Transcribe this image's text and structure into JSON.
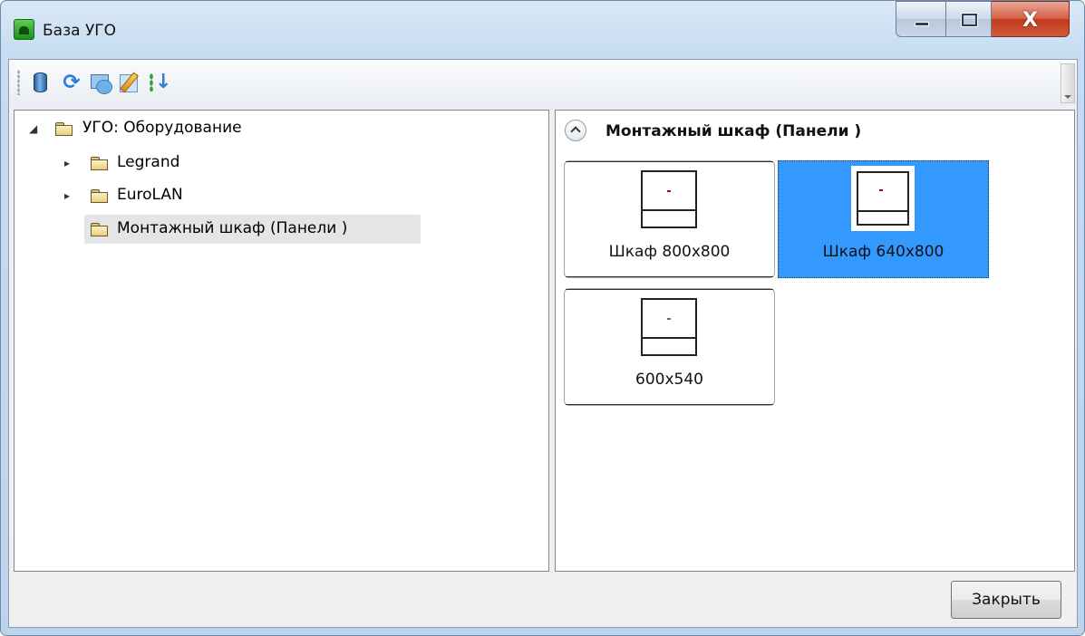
{
  "window": {
    "title": "База УГО",
    "icon": "app-icon",
    "controls": [
      "minimize-icon",
      "maximize-icon",
      "close-icon"
    ],
    "close_glyph": "X"
  },
  "toolbar": {
    "buttons": [
      {
        "icon": "database-icon"
      },
      {
        "icon": "refresh-icon"
      },
      {
        "icon": "sync-icon"
      },
      {
        "icon": "edit-icon"
      },
      {
        "icon": "sort-icon"
      }
    ]
  },
  "tree": {
    "root": {
      "label": "УГО: Оборудование",
      "expanded": true
    },
    "children": [
      {
        "label": "Legrand",
        "expanded": false
      },
      {
        "label": "EuroLAN",
        "expanded": false
      },
      {
        "label": "Монтажный шкаф (Панели )",
        "selected": true
      }
    ]
  },
  "gallery": {
    "group_title": "Монтажный шкаф (Панели )",
    "items": [
      {
        "label": "Шкаф 800x800",
        "selected": false
      },
      {
        "label": "Шкаф 640x800",
        "selected": true
      },
      {
        "label": "600x540",
        "selected": false
      }
    ]
  },
  "footer": {
    "close_label": "Закрыть"
  },
  "colors": {
    "selection": "#3399ff",
    "tree_selection": "#e5e5e5",
    "close_button": "#c13a1c"
  }
}
